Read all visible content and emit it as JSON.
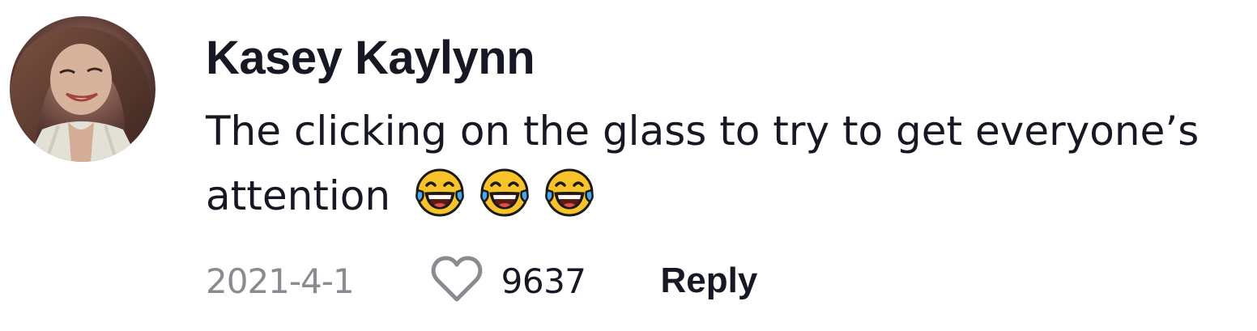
{
  "comment": {
    "username": "Kasey Kaylynn",
    "text": "The clicking on the glass to try to get everyone’s attention",
    "emojis": [
      "face-with-tears-of-joy-icon",
      "face-with-tears-of-joy-icon",
      "face-with-tears-of-joy-icon"
    ],
    "date": "2021-4-1",
    "like_count": "9637",
    "reply_label": "Reply",
    "avatar": "profile-photo"
  },
  "colors": {
    "text_primary": "#161823",
    "text_secondary": "#8a8b91",
    "emoji_yellow": "#f7c22a",
    "emoji_tear": "#4aa8e8"
  }
}
